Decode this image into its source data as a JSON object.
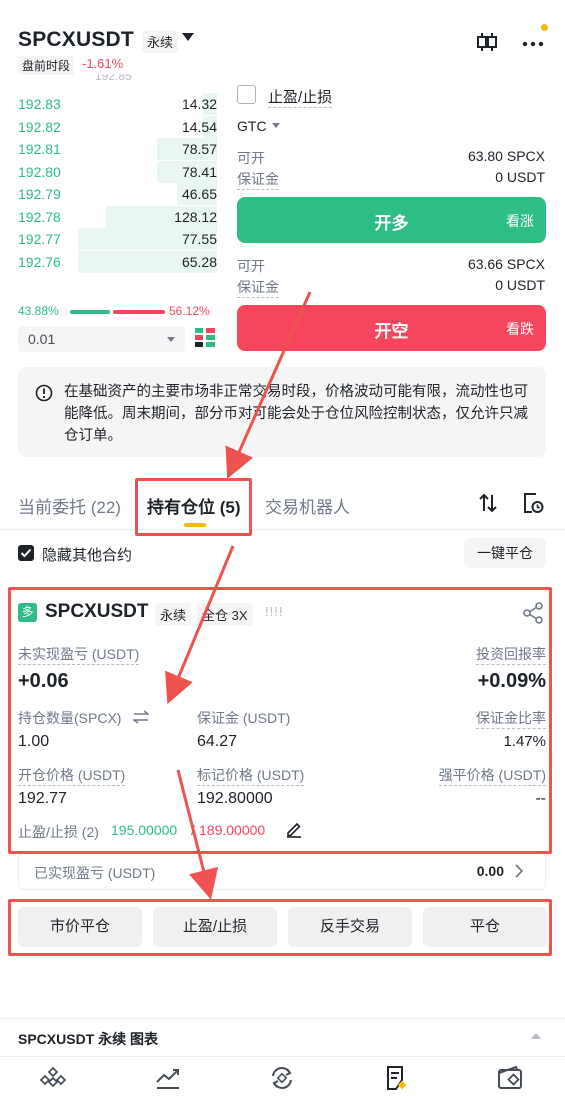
{
  "header": {
    "symbol": "SPCXUSDT",
    "contract_type": "永续",
    "session": "盘前时段",
    "change": "-1.61%"
  },
  "orderbook": {
    "cut_price": "192.85",
    "rows": [
      {
        "price": "192.83",
        "qty": "14.32",
        "depth": 0.07
      },
      {
        "price": "192.82",
        "qty": "14.54",
        "depth": 0.07
      },
      {
        "price": "192.81",
        "qty": "78.57",
        "depth": 0.3
      },
      {
        "price": "192.80",
        "qty": "78.41",
        "depth": 0.3
      },
      {
        "price": "192.79",
        "qty": "46.65",
        "depth": 0.2
      },
      {
        "price": "192.78",
        "qty": "128.12",
        "depth": 0.56
      },
      {
        "price": "192.77",
        "qty": "77.55",
        "depth": 0.7
      },
      {
        "price": "192.76",
        "qty": "65.28",
        "depth": 0.7
      }
    ],
    "buy_ratio": "43.88%",
    "sell_ratio": "56.12%",
    "precision": "0.01"
  },
  "order_panel": {
    "tpsl_label": "止盈/止损",
    "tif": "GTC",
    "long": {
      "avail_label": "可开",
      "avail_value": "63.80 SPCX",
      "margin_label": "保证金",
      "margin_value": "0 USDT",
      "button": "开多",
      "sub": "看涨"
    },
    "short": {
      "avail_label": "可开",
      "avail_value": "63.66 SPCX",
      "margin_label": "保证金",
      "margin_value": "0 USDT",
      "button": "开空",
      "sub": "看跌"
    }
  },
  "notice": {
    "text": "在基础资产的主要市场非正常交易时段，价格波动可能有限，流动性也可能降低。周末期间，部分币对可能会处于仓位风险控制状态，仅允许只减仓订单。"
  },
  "tabs": {
    "open_orders": "当前委托 (22)",
    "positions": "持有仓位 (5)",
    "bots": "交易机器人"
  },
  "filter": {
    "hide_label": "隐藏其他合约",
    "close_all": "一键平仓"
  },
  "position": {
    "badge": "多",
    "symbol": "SPCXUSDT",
    "contract_type": "永续",
    "margin_mode": "全仓 3X",
    "signal": "!!!!",
    "unrealized_label": "未实现盈亏 (USDT)",
    "unrealized_value": "+0.06",
    "roi_label": "投资回报率",
    "roi_value": "+0.09%",
    "size_label": "持仓数量(SPCX)",
    "size_value": "1.00",
    "margin_label": "保证金 (USDT)",
    "margin_value": "64.27",
    "margin_ratio_label": "保证金比率",
    "margin_ratio_value": "1.47%",
    "entry_label": "开仓价格 (USDT)",
    "entry_value": "192.77",
    "mark_label": "标记价格 (USDT)",
    "mark_value": "192.80000",
    "liq_label": "强平价格 (USDT)",
    "liq_value": "--",
    "tpsl_label": "止盈/止损 (2)",
    "tp_value": "195.00000",
    "sl_value": "189.00000",
    "realized_label": "已实现盈亏 (USDT)",
    "realized_value": "0.00"
  },
  "actions": {
    "market_close": "市价平仓",
    "tpsl": "止盈/止损",
    "reverse": "反手交易",
    "close": "平仓"
  },
  "chart_bar": {
    "label": "SPCXUSDT 永续 图表"
  },
  "colors": {
    "green": "#2ebd85",
    "red": "#f6465d",
    "accent": "#f0b90b",
    "annotation": "#ef5350"
  }
}
